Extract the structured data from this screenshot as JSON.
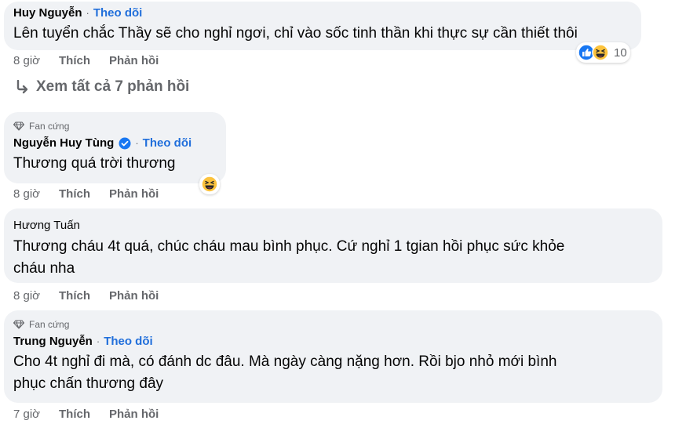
{
  "comments": [
    {
      "author": "Huy Nguyễn",
      "follow": "Theo dõi",
      "text": "Lên tuyển chắc Thầy sẽ cho nghỉ ngơi, chỉ vào sốc tinh thần khi thực sự cần thiết thôi",
      "time": "8 giờ",
      "like": "Thích",
      "reply": "Phản hồi",
      "reaction_count": "10"
    },
    {
      "badge": "Fan cứng",
      "author": "Nguyễn Huy Tùng",
      "follow": "Theo dõi",
      "text": "Thương quá trời thương",
      "time": "8 giờ",
      "like": "Thích",
      "reply": "Phản hồi"
    },
    {
      "author": "Hương Tuấn",
      "text_line1": "Thương cháu 4t quá, chúc cháu mau bình phục. Cứ nghỉ 1 tgian hồi phục sức khỏe",
      "text_line2": "cháu nha",
      "time": "8 giờ",
      "like": "Thích",
      "reply": "Phản hồi"
    },
    {
      "badge": "Fan cứng",
      "author": "Trung Nguyễn",
      "follow": "Theo dõi",
      "text_line1": "Cho 4t nghỉ đi mà, có đánh dc đâu. Mà ngày càng nặng hơn. Rồi bjo nhỏ mới bình",
      "text_line2": "phục chấn thương đây",
      "time": "7 giờ",
      "like": "Thích",
      "reply": "Phản hồi"
    }
  ],
  "view_all_replies": "Xem tất cả 7 phản hồi",
  "colors": {
    "link": "#216fdb",
    "meta": "#65676b",
    "bubble": "#f0f2f5"
  },
  "icons": [
    "reply-arrow-icon",
    "diamond-icon",
    "verified-badge-icon",
    "like-reaction-icon",
    "haha-reaction-icon"
  ]
}
